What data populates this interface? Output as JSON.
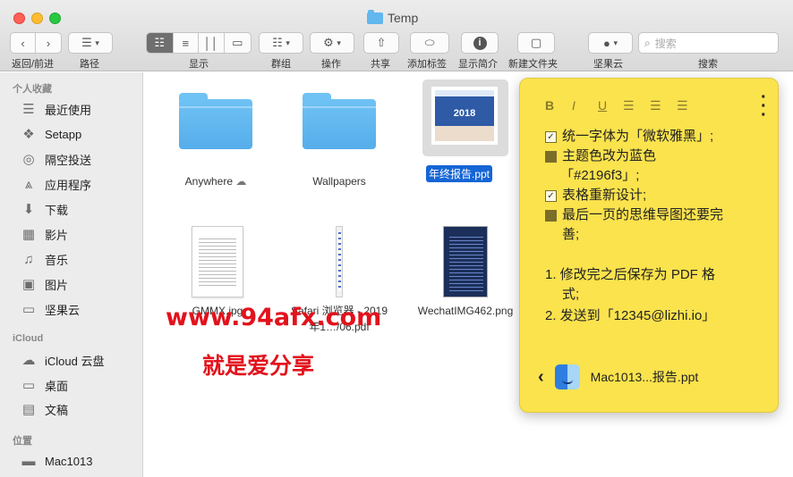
{
  "window": {
    "title": "Temp"
  },
  "toolbar": {
    "back_forward_label": "返回/前进",
    "path_label": "路径",
    "view_label": "显示",
    "group_label": "群组",
    "action_label": "操作",
    "share_label": "共享",
    "tags_label": "添加标签",
    "info_label": "显示简介",
    "new_folder_label": "新建文件夹",
    "nutcloud_label": "坚果云",
    "search_label": "搜索",
    "search_placeholder": "搜索"
  },
  "sidebar": {
    "favorites_header": "个人收藏",
    "favorites": [
      {
        "label": "最近使用",
        "icon": "recents-icon"
      },
      {
        "label": "Setapp",
        "icon": "setapp-icon"
      },
      {
        "label": "隔空投送",
        "icon": "airdrop-icon"
      },
      {
        "label": "应用程序",
        "icon": "applications-icon"
      },
      {
        "label": "下载",
        "icon": "downloads-icon"
      },
      {
        "label": "影片",
        "icon": "movies-icon"
      },
      {
        "label": "音乐",
        "icon": "music-icon"
      },
      {
        "label": "图片",
        "icon": "pictures-icon"
      },
      {
        "label": "坚果云",
        "icon": "folder-icon"
      }
    ],
    "icloud_header": "iCloud",
    "icloud": [
      {
        "label": "iCloud 云盘",
        "icon": "cloud-icon"
      },
      {
        "label": "桌面",
        "icon": "desktop-icon"
      },
      {
        "label": "文稿",
        "icon": "documents-icon"
      }
    ],
    "locations_header": "位置",
    "locations": [
      {
        "label": "Mac1013",
        "icon": "disk-icon"
      }
    ]
  },
  "files": [
    {
      "name": "Anywhere",
      "kind": "folder"
    },
    {
      "name": "Wallpapers",
      "kind": "folder"
    },
    {
      "name": "年终报告.ppt",
      "kind": "ppt",
      "selected": true,
      "thumb_text": "2018"
    },
    {
      "name": "GMMX.jpg",
      "kind": "doc"
    },
    {
      "name": "Safari 浏览器 - 2019年1…/06.pdf",
      "kind": "strip"
    },
    {
      "name": "WechatIMG462.png",
      "kind": "image"
    }
  ],
  "watermark": {
    "line1": "www.94afx.com",
    "line2": "就是爱分享"
  },
  "note": {
    "format_tools": [
      "B",
      "I",
      "U",
      "bullet-list-icon",
      "numbered-list-icon",
      "checklist-icon"
    ],
    "lines": [
      {
        "type": "check",
        "checked": true,
        "text": "统一字体为「微软雅黑」;"
      },
      {
        "type": "check",
        "checked": false,
        "text": "主题色改为蓝色"
      },
      {
        "type": "cont",
        "text": "「#2196f3」;"
      },
      {
        "type": "check",
        "checked": true,
        "text": "表格重新设计;"
      },
      {
        "type": "check",
        "checked": false,
        "text": "最后一页的思维导图还要完"
      },
      {
        "type": "cont",
        "text": "善;"
      },
      {
        "type": "num",
        "text": "1. 修改完之后保存为 PDF 格"
      },
      {
        "type": "cont2",
        "text": "式;"
      },
      {
        "type": "num",
        "text": "2. 发送到「12345@lizhi.io」"
      }
    ],
    "attachment": "Mac1013...报告.ppt"
  }
}
